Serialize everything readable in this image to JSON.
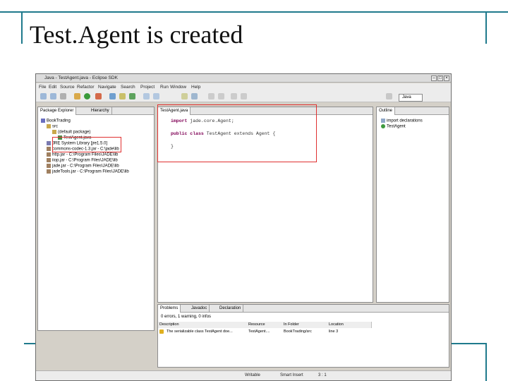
{
  "slide": {
    "title": "Test.Agent is created"
  },
  "window": {
    "title": "Java - TestAgent.java - Eclipse SDK"
  },
  "menu": [
    "File",
    "Edit",
    "Source",
    "Refactor",
    "Navigate",
    "Search",
    "Project",
    "Run",
    "Window",
    "Help"
  ],
  "perspective": "Java",
  "left_panel": {
    "tabs": [
      "Package Explorer",
      "Hierarchy"
    ],
    "tree": [
      {
        "label": "BookTrading"
      },
      {
        "label": "src"
      },
      {
        "label": "(default package)"
      },
      {
        "label": "TestAgent.java"
      },
      {
        "label": "JRE System Library [jre1.5.0]"
      },
      {
        "label": "commons-codec-1.3.jar - C:\\jade\\lib"
      },
      {
        "label": "http.jar - C:\\Program Files\\JADE\\lib"
      },
      {
        "label": "iiop.jar - C:\\Program Files\\JADE\\lib"
      },
      {
        "label": "jade.jar - C:\\Program Files\\JADE\\lib"
      },
      {
        "label": "jadeTools.jar - C:\\Program Files\\JADE\\lib"
      }
    ]
  },
  "editor": {
    "tab": "TestAgent.java",
    "line1_kw": "import",
    "line1_rest": " jade.core.Agent;",
    "line2_kw": "public class",
    "line2_rest": " TestAgent extends Agent {",
    "line3": "}"
  },
  "outline": {
    "tab": "Outline",
    "items": [
      "import declarations",
      "TestAgent"
    ]
  },
  "problems": {
    "tabs": [
      "Problems",
      "Javadoc",
      "Declaration"
    ],
    "summary": "0 errors, 1 warning, 0 infos",
    "headers": [
      "Description",
      "Resource",
      "In Folder",
      "Location"
    ],
    "rows": [
      {
        "description": "The serializable class TestAgent doe...",
        "resource": "TestAgent....",
        "folder": "BookTrading/src",
        "location": "line 3"
      }
    ]
  },
  "status": {
    "writable": "Writable",
    "insert": "Smart Insert",
    "position": "3 : 1"
  }
}
